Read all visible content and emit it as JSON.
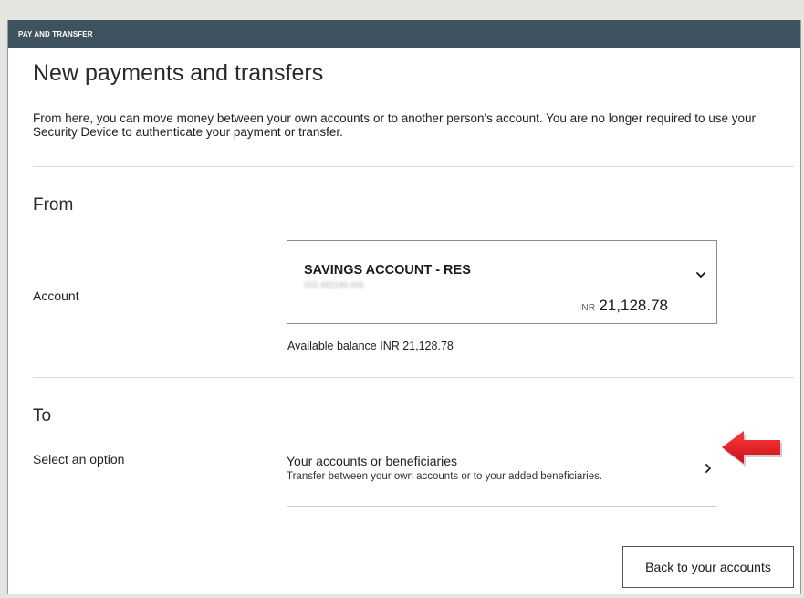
{
  "header": {
    "title": "PAY AND TRANSFER"
  },
  "page": {
    "title": "New payments and transfers",
    "intro": "From here, you can move money between your own accounts or to another person's account. You are no longer required to use your Security Device to authenticate your payment or transfer."
  },
  "from": {
    "section_title": "From",
    "account_label": "Account",
    "selected_account": {
      "name": "SAVINGS ACCOUNT - RES",
      "number": "002-483196-006",
      "currency": "INR",
      "balance": "21,128.78",
      "dropdown_icon": "chevron-down-icon"
    },
    "available_balance": "Available balance INR 21,128.78"
  },
  "to": {
    "section_title": "To",
    "option_label": "Select an option",
    "option": {
      "title": "Your accounts or beneficiaries",
      "subtitle": "Transfer between your own accounts or to your added beneficiaries.",
      "icon": "chevron-right-icon"
    }
  },
  "footer": {
    "back_button_label": "Back to your accounts"
  },
  "annotation": {
    "icon": "red-arrow-icon",
    "color": "#e3191f"
  },
  "colors": {
    "header_bar": "#3f5260",
    "background": "#ffffff"
  }
}
